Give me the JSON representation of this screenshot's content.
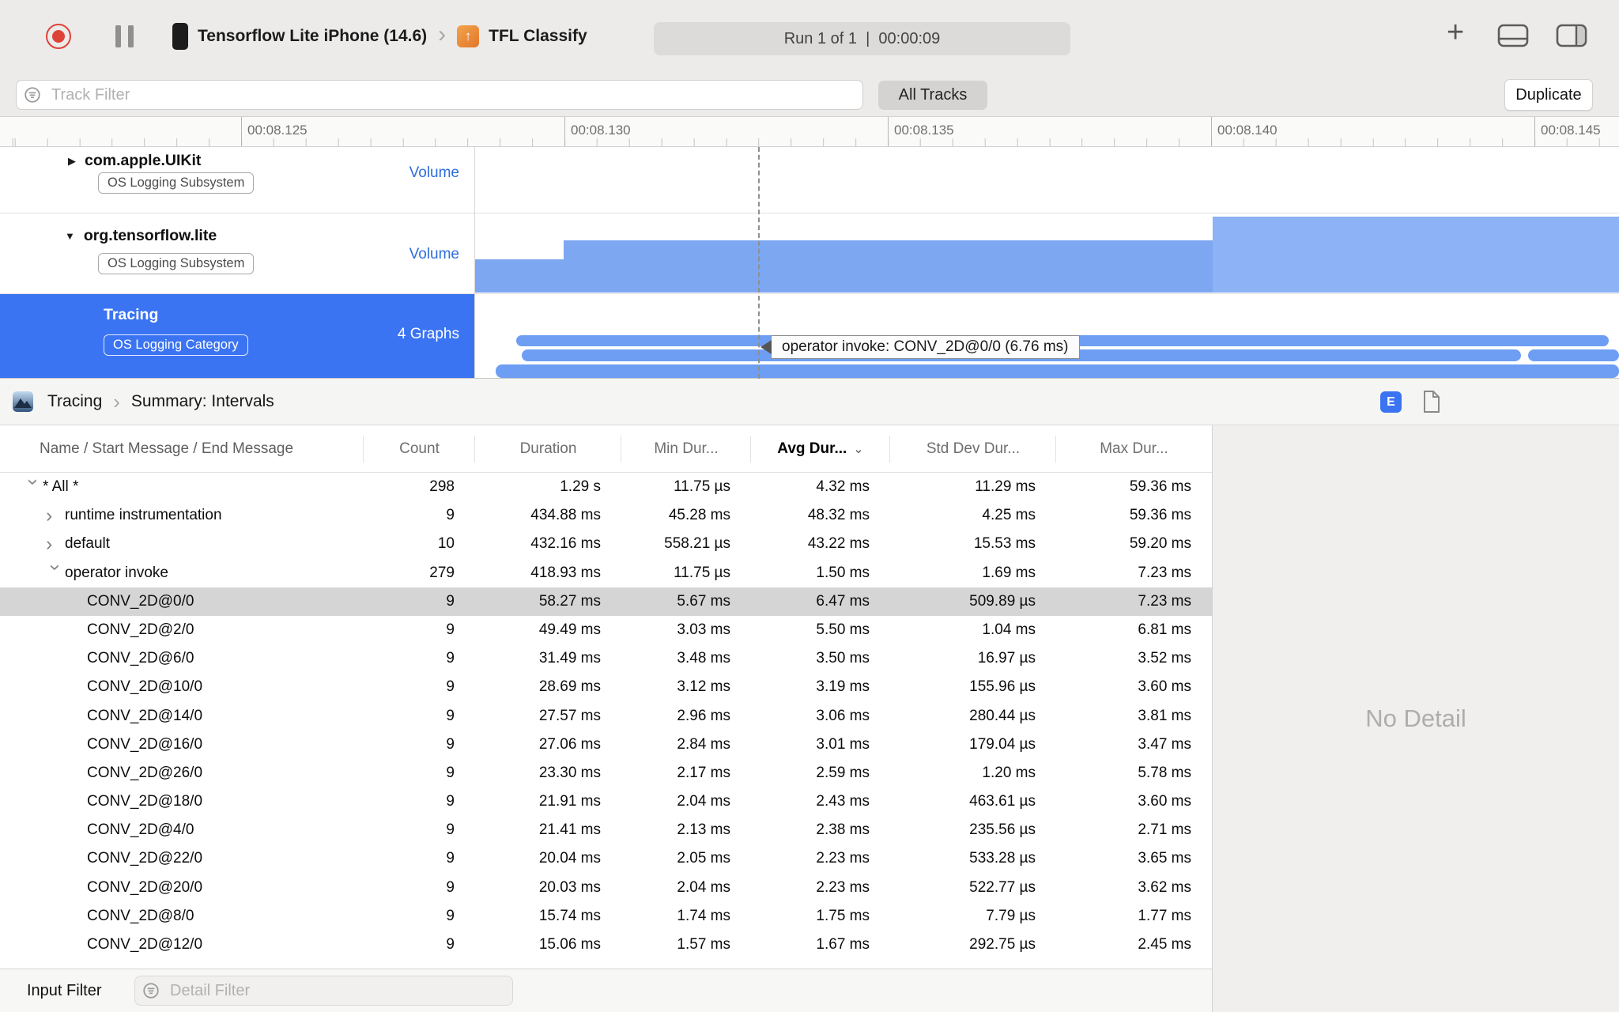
{
  "toolbar": {
    "device_name": "Tensorflow Lite iPhone (14.6)",
    "app_name": "TFL Classify",
    "run_status": "Run 1 of 1  |  00:00:09"
  },
  "filter_bar": {
    "track_filter_placeholder": "Track Filter",
    "all_tracks": "All Tracks",
    "duplicate": "Duplicate"
  },
  "timeline": {
    "ruler_labels": [
      "00:08.125",
      "00:08.130",
      "00:08.135",
      "00:08.140",
      "00:08.145"
    ],
    "tooltip": "operator invoke: CONV_2D@0/0 (6.76 ms)",
    "tracks": [
      {
        "name": "com.apple.UIKit",
        "badge": "OS Logging Subsystem",
        "lane_label": "Volume"
      },
      {
        "name": "org.tensorflow.lite",
        "badge": "OS Logging Subsystem",
        "lane_label": "Volume"
      },
      {
        "name": "Tracing",
        "badge": "OS Logging Category",
        "lane_label": "4 Graphs"
      }
    ]
  },
  "detail_header": {
    "breadcrumb_root": "Tracing",
    "breadcrumb_leaf": "Summary: Intervals",
    "view_toggle_label": "E"
  },
  "table": {
    "columns": [
      "Name / Start Message / End Message",
      "Count",
      "Duration",
      "Min Dur...",
      "Avg Dur...",
      "Std Dev Dur...",
      "Max Dur..."
    ],
    "sorted_column": "Avg Dur...",
    "rows": [
      {
        "name": "* All *",
        "level": 0,
        "disclosure": "open",
        "selected": false,
        "count": "298",
        "duration": "1.29 s",
        "min": "11.75 µs",
        "avg": "4.32 ms",
        "std": "11.29 ms",
        "max": "59.36 ms"
      },
      {
        "name": "runtime instrumentation",
        "level": 1,
        "disclosure": "closed",
        "selected": false,
        "count": "9",
        "duration": "434.88 ms",
        "min": "45.28 ms",
        "avg": "48.32 ms",
        "std": "4.25 ms",
        "max": "59.36 ms"
      },
      {
        "name": "default",
        "level": 1,
        "disclosure": "closed",
        "selected": false,
        "count": "10",
        "duration": "432.16 ms",
        "min": "558.21 µs",
        "avg": "43.22 ms",
        "std": "15.53 ms",
        "max": "59.20 ms"
      },
      {
        "name": "operator invoke",
        "level": 1,
        "disclosure": "open",
        "selected": false,
        "count": "279",
        "duration": "418.93 ms",
        "min": "11.75 µs",
        "avg": "1.50 ms",
        "std": "1.69 ms",
        "max": "7.23 ms"
      },
      {
        "name": "CONV_2D@0/0",
        "level": 2,
        "disclosure": "none",
        "selected": true,
        "count": "9",
        "duration": "58.27 ms",
        "min": "5.67 ms",
        "avg": "6.47 ms",
        "std": "509.89 µs",
        "max": "7.23 ms"
      },
      {
        "name": "CONV_2D@2/0",
        "level": 2,
        "disclosure": "none",
        "selected": false,
        "count": "9",
        "duration": "49.49 ms",
        "min": "3.03 ms",
        "avg": "5.50 ms",
        "std": "1.04 ms",
        "max": "6.81 ms"
      },
      {
        "name": "CONV_2D@6/0",
        "level": 2,
        "disclosure": "none",
        "selected": false,
        "count": "9",
        "duration": "31.49 ms",
        "min": "3.48 ms",
        "avg": "3.50 ms",
        "std": "16.97 µs",
        "max": "3.52 ms"
      },
      {
        "name": "CONV_2D@10/0",
        "level": 2,
        "disclosure": "none",
        "selected": false,
        "count": "9",
        "duration": "28.69 ms",
        "min": "3.12 ms",
        "avg": "3.19 ms",
        "std": "155.96 µs",
        "max": "3.60 ms"
      },
      {
        "name": "CONV_2D@14/0",
        "level": 2,
        "disclosure": "none",
        "selected": false,
        "count": "9",
        "duration": "27.57 ms",
        "min": "2.96 ms",
        "avg": "3.06 ms",
        "std": "280.44 µs",
        "max": "3.81 ms"
      },
      {
        "name": "CONV_2D@16/0",
        "level": 2,
        "disclosure": "none",
        "selected": false,
        "count": "9",
        "duration": "27.06 ms",
        "min": "2.84 ms",
        "avg": "3.01 ms",
        "std": "179.04 µs",
        "max": "3.47 ms"
      },
      {
        "name": "CONV_2D@26/0",
        "level": 2,
        "disclosure": "none",
        "selected": false,
        "count": "9",
        "duration": "23.30 ms",
        "min": "2.17 ms",
        "avg": "2.59 ms",
        "std": "1.20 ms",
        "max": "5.78 ms"
      },
      {
        "name": "CONV_2D@18/0",
        "level": 2,
        "disclosure": "none",
        "selected": false,
        "count": "9",
        "duration": "21.91 ms",
        "min": "2.04 ms",
        "avg": "2.43 ms",
        "std": "463.61 µs",
        "max": "3.60 ms"
      },
      {
        "name": "CONV_2D@4/0",
        "level": 2,
        "disclosure": "none",
        "selected": false,
        "count": "9",
        "duration": "21.41 ms",
        "min": "2.13 ms",
        "avg": "2.38 ms",
        "std": "235.56 µs",
        "max": "2.71 ms"
      },
      {
        "name": "CONV_2D@22/0",
        "level": 2,
        "disclosure": "none",
        "selected": false,
        "count": "9",
        "duration": "20.04 ms",
        "min": "2.05 ms",
        "avg": "2.23 ms",
        "std": "533.28 µs",
        "max": "3.65 ms"
      },
      {
        "name": "CONV_2D@20/0",
        "level": 2,
        "disclosure": "none",
        "selected": false,
        "count": "9",
        "duration": "20.03 ms",
        "min": "2.04 ms",
        "avg": "2.23 ms",
        "std": "522.77 µs",
        "max": "3.62 ms"
      },
      {
        "name": "CONV_2D@8/0",
        "level": 2,
        "disclosure": "none",
        "selected": false,
        "count": "9",
        "duration": "15.74 ms",
        "min": "1.74 ms",
        "avg": "1.75 ms",
        "std": "7.79 µs",
        "max": "1.77 ms"
      },
      {
        "name": "CONV_2D@12/0",
        "level": 2,
        "disclosure": "none",
        "selected": false,
        "count": "9",
        "duration": "15.06 ms",
        "min": "1.57 ms",
        "avg": "1.67 ms",
        "std": "292.75 µs",
        "max": "2.45 ms"
      }
    ]
  },
  "detail_panel": {
    "empty_text": "No Detail"
  },
  "bottom_bar": {
    "label": "Input Filter",
    "detail_filter_placeholder": "Detail Filter"
  },
  "icons": {
    "chevron_right": "›",
    "plus": "+",
    "sort_down_chevron": "⌄",
    "disclosure_open": "▼",
    "disclosure_closed": "▶",
    "row_chevron": "›",
    "target_app_arrow": "↑"
  },
  "colors": {
    "accent_blue": "#3b74f2",
    "track_fill_blue": "#7ea7f2",
    "interval_bar_blue": "#6d9ef4",
    "record_red": "#de4237",
    "selection_gray": "#d5d5d5"
  }
}
